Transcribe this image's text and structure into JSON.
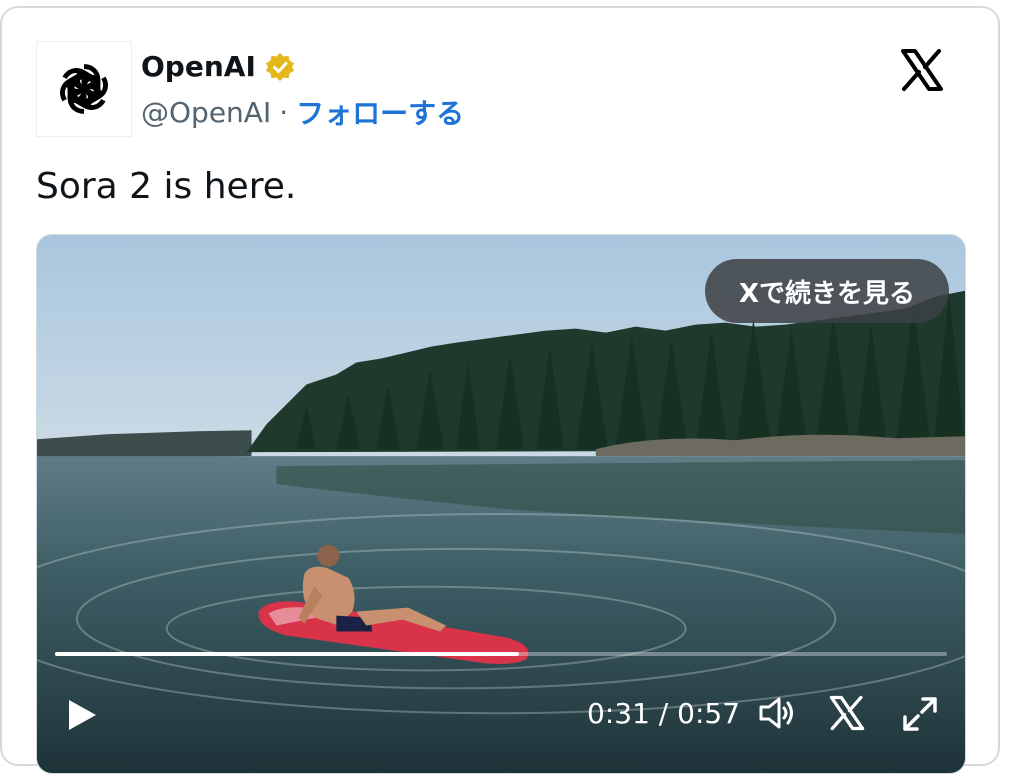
{
  "post": {
    "author_name": "OpenAI",
    "handle": "@OpenAI",
    "separator": "·",
    "follow_label": "フォローする",
    "text": "Sora 2 is here."
  },
  "video": {
    "cta_label": "Xで続きを見る",
    "current_time": "0:31",
    "time_separator": " / ",
    "duration": "0:57",
    "progress_fraction": 0.52
  },
  "icons": {
    "avatar": "openai-logo-icon",
    "verified": "verified-badge-icon",
    "brand": "x-logo-icon",
    "play": "play-icon",
    "volume": "volume-icon",
    "x_control": "x-logo-icon",
    "fullscreen": "fullscreen-icon"
  },
  "colors": {
    "follow": "#1d74d6",
    "verified": "#e2b719",
    "text": "#0f1419",
    "muted": "#536471"
  }
}
